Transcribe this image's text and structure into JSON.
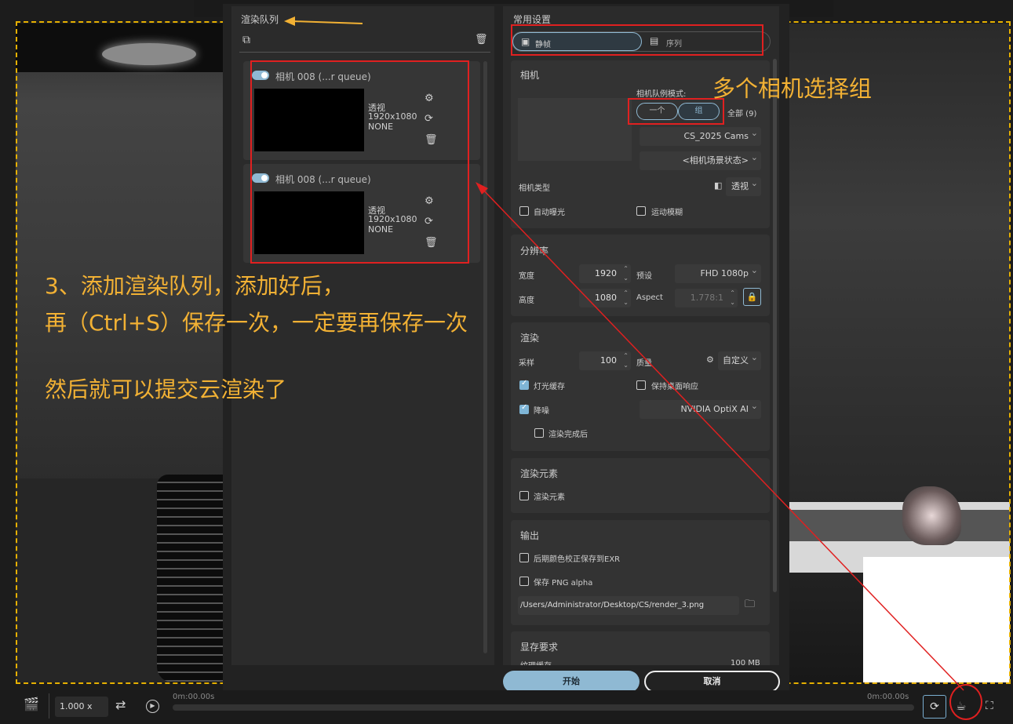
{
  "queue": {
    "title": "渲染队列",
    "items": [
      {
        "name": "相机 008 (...r queue)",
        "type": "透视",
        "resolution": "1920x1080",
        "effect": "NONE"
      },
      {
        "name": "相机 008 (...r queue)",
        "type": "透视",
        "resolution": "1920x1080",
        "effect": "NONE"
      }
    ]
  },
  "settings": {
    "title": "常用设置",
    "modes": {
      "still": "静帧",
      "sequence": "序列"
    },
    "camera": {
      "section": "相机",
      "queue_mode_label": "相机队例模式:",
      "mode_one": "一个",
      "mode_group": "组",
      "all_label": "全部 (9)",
      "group_select": "CS_2025 Cams",
      "state_select": "<相机场景状态>",
      "type_label": "相机类型",
      "type_value": "透视",
      "auto_exposure": "自动曝光",
      "motion_blur": "运动模糊"
    },
    "resolution": {
      "section": "分辨率",
      "width_label": "宽度",
      "width": "1920",
      "height_label": "高度",
      "height": "1080",
      "preset_label": "预设",
      "preset": "FHD 1080p",
      "aspect_label": "Aspect",
      "aspect": "1.778:1"
    },
    "render": {
      "section": "渲染",
      "samples_label": "采样",
      "samples": "100",
      "quality_label": "质量",
      "quality": "自定义",
      "light_cache": "灯光缓存",
      "light_cache_checked": true,
      "keep_desktop": "保持桌面响应",
      "keep_desktop_checked": false,
      "denoise": "降噪",
      "denoise_checked": true,
      "denoiser": "NVIDIA OptiX AI",
      "after_render": "渲染完成后",
      "after_render_checked": false
    },
    "elements": {
      "section": "渲染元素",
      "checkbox": "渲染元素"
    },
    "output": {
      "section": "输出",
      "save_exr": "后期颜色校正保存到EXR",
      "save_png_alpha": "保存 PNG alpha",
      "path": "/Users/Administrator/Desktop/CS/render_3.png"
    },
    "memory": {
      "section": "显存要求",
      "row_label": "纹理缓存",
      "row_value": "100 MB"
    }
  },
  "actions": {
    "start": "开始",
    "cancel": "取消"
  },
  "timeline": {
    "speed": "1.000 x",
    "time_left": "0m:00.00s",
    "time_right": "0m:00.00s"
  },
  "annotations": {
    "camera_group": "多个相机选择组",
    "step_line1": "3、添加渲染队列，添加好后，",
    "step_line2": "再（Ctrl+S）保存一次，一定要再保存一次",
    "step_line3": "然后就可以提交云渲染了"
  },
  "colors": {
    "accent": "#8fb9d3",
    "annotation": "#f2b134",
    "highlight": "#e02020",
    "frame": "#e6b000"
  }
}
